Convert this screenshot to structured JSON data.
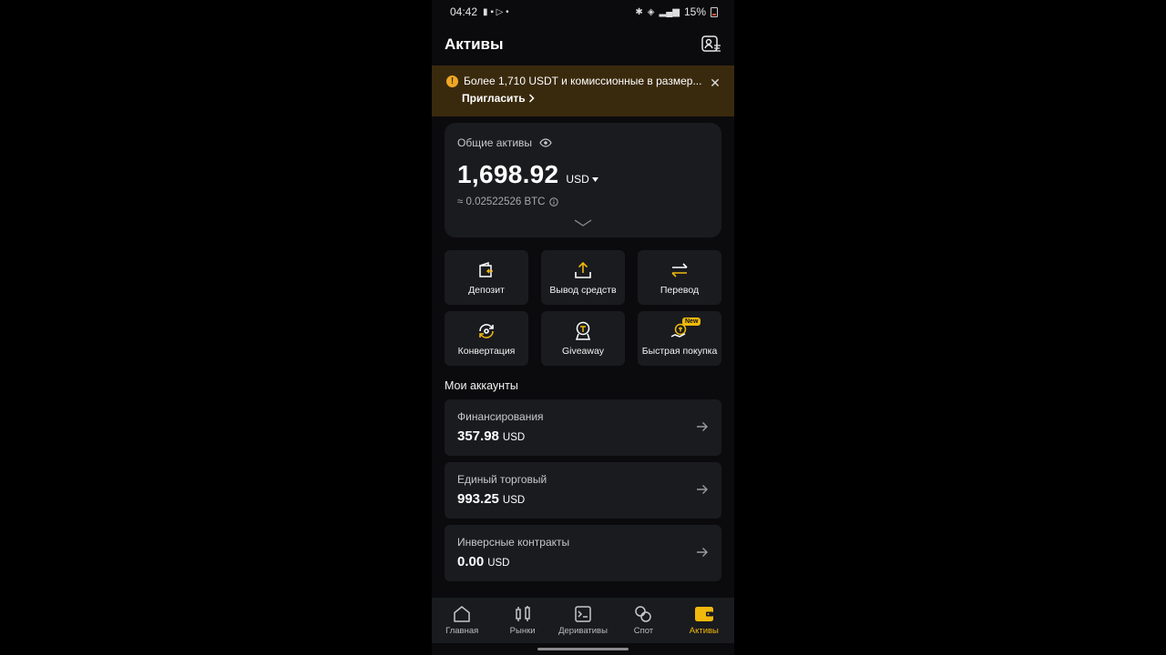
{
  "status_bar": {
    "time": "04:42",
    "battery": "15%"
  },
  "header": {
    "title": "Активы"
  },
  "banner": {
    "text": "Более 1,710 USDT и комиссионные в размер...",
    "link": "Пригласить"
  },
  "total": {
    "label": "Общие активы",
    "amount": "1,698.92",
    "currency": "USD",
    "btc": "≈ 0.02522526 BTC"
  },
  "actions": [
    {
      "label": "Депозит",
      "icon": "deposit-icon"
    },
    {
      "label": "Вывод средств",
      "icon": "withdraw-icon"
    },
    {
      "label": "Перевод",
      "icon": "transfer-icon"
    },
    {
      "label": "Конвертация",
      "icon": "convert-icon"
    },
    {
      "label": "Giveaway",
      "icon": "giveaway-icon"
    },
    {
      "label": "Быстрая покупка",
      "icon": "quick-buy-icon",
      "badge": "New"
    }
  ],
  "accounts_title": "Мои аккаунты",
  "accounts": [
    {
      "name": "Финансирования",
      "value": "357.98",
      "currency": "USD"
    },
    {
      "name": "Единый торговый",
      "value": "993.25",
      "currency": "USD"
    },
    {
      "name": "Инверсные контракты",
      "value": "0.00",
      "currency": "USD"
    }
  ],
  "nav": [
    {
      "label": "Главная",
      "icon": "home-icon"
    },
    {
      "label": "Рынки",
      "icon": "markets-icon"
    },
    {
      "label": "Деривативы",
      "icon": "derivatives-icon"
    },
    {
      "label": "Спот",
      "icon": "spot-icon"
    },
    {
      "label": "Активы",
      "icon": "wallet-icon",
      "active": true
    }
  ],
  "colors": {
    "accent": "#f0b90b",
    "card": "#1a1b1f",
    "banner": "#3a2a0d"
  }
}
